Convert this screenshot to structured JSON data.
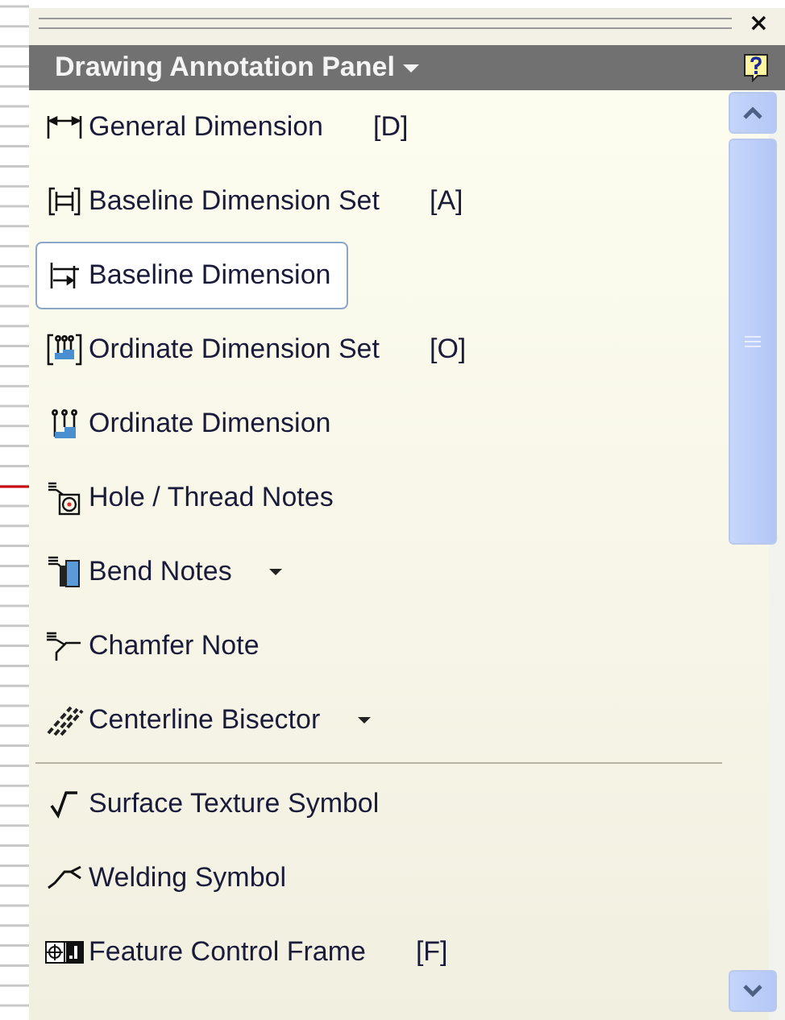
{
  "panel": {
    "title": "Drawing Annotation Panel",
    "close_glyph": "×",
    "items": [
      {
        "kind": "tool",
        "label": "General Dimension",
        "shortcut": "[D]",
        "selected": false,
        "dropdown": false
      },
      {
        "kind": "tool",
        "label": "Baseline Dimension Set",
        "shortcut": "[A]",
        "selected": false,
        "dropdown": false
      },
      {
        "kind": "tool",
        "label": "Baseline Dimension",
        "selected": true,
        "dropdown": false
      },
      {
        "kind": "tool",
        "label": "Ordinate Dimension Set",
        "shortcut": "[O]",
        "selected": false,
        "dropdown": false
      },
      {
        "kind": "tool",
        "label": "Ordinate Dimension",
        "selected": false,
        "dropdown": false
      },
      {
        "kind": "tool",
        "label": "Hole / Thread Notes",
        "selected": false,
        "dropdown": false
      },
      {
        "kind": "tool",
        "label": "Bend Notes",
        "selected": false,
        "dropdown": true
      },
      {
        "kind": "tool",
        "label": "Chamfer Note",
        "selected": false,
        "dropdown": false
      },
      {
        "kind": "tool",
        "label": "Centerline Bisector",
        "selected": false,
        "dropdown": true
      },
      {
        "kind": "separator"
      },
      {
        "kind": "tool",
        "label": "Surface Texture Symbol",
        "selected": false,
        "dropdown": false
      },
      {
        "kind": "tool",
        "label": "Welding Symbol",
        "selected": false,
        "dropdown": false
      },
      {
        "kind": "tool",
        "label": "Feature Control Frame",
        "shortcut": "[F]",
        "selected": false,
        "dropdown": false
      }
    ]
  }
}
